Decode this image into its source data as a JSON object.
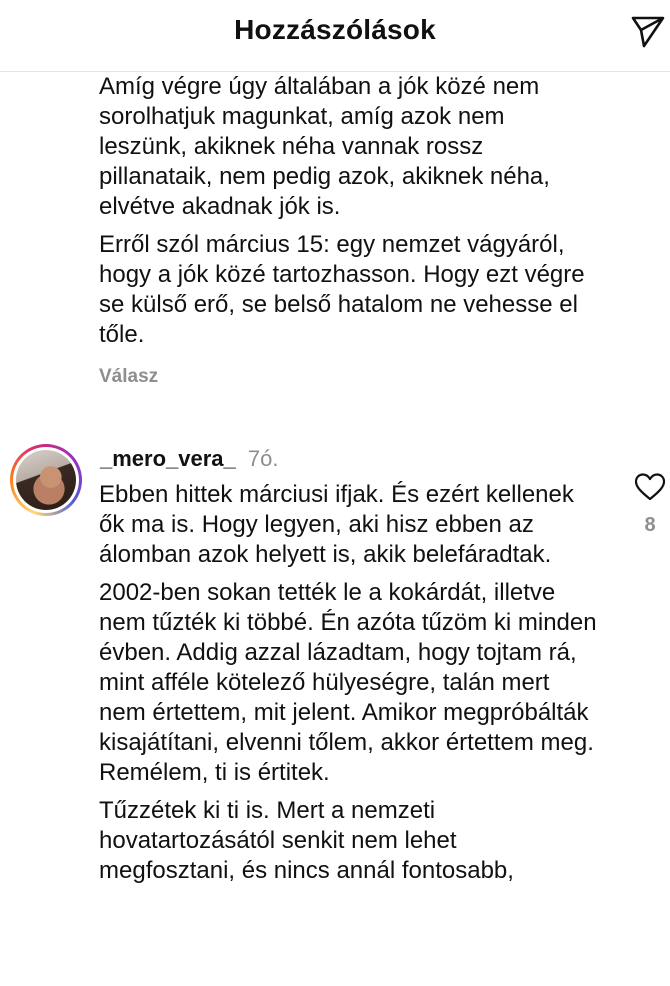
{
  "header": {
    "title": "Hozzászólások",
    "send_icon": "send-icon"
  },
  "previous_comment": {
    "paragraphs": [
      "Amíg végre úgy általában a jók közé nem sorolhatjuk magunkat, amíg azok nem leszünk, akiknek néha vannak rossz pillanataik, nem pedig azok, akiknek néha, elvétve akadnak jók is.",
      "Erről szól március 15: egy nemzet vágyáról, hogy a jók közé tartozhasson. Hogy ezt végre se külső erő, se belső hatalom ne vehesse el tőle."
    ],
    "reply_label": "Válasz"
  },
  "comment": {
    "username": "_mero_vera_",
    "time": "7ó.",
    "avatar_icon": "avatar",
    "paragraphs": [
      "Ebben hittek márciusi ifjak. És ezért kellenek ők ma is. Hogy legyen, aki hisz ebben az álomban azok helyett is, akik belefáradtak.",
      "2002-ben sokan tették le a kokárdát, illetve nem tűzték ki többé. Én azóta tűzöm ki minden évben. Addig azzal lázadtam, hogy tojtam rá, mint afféle kötelező hülyeségre, talán mert nem értettem, mit jelent. Amikor megpróbálták kisajátítani, elvenni tőlem, akkor értettem meg. Remélem, ti is értitek.",
      "Tűzzétek ki ti is. Mert a nemzeti hovatartozásától senkit nem lehet megfosztani, és nincs annál fontosabb,"
    ],
    "like_count": "8",
    "like_icon": "heart-icon"
  },
  "colors": {
    "text": "#111111",
    "muted": "#8e8e8e",
    "divider": "#e4e4e4"
  }
}
